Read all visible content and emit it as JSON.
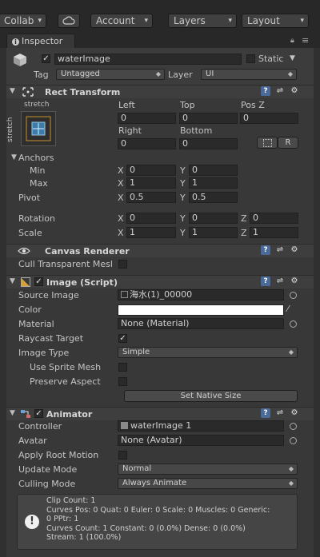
{
  "toolbar": {
    "collab": "Collab",
    "account": "Account",
    "layers": "Layers",
    "layout": "Layout"
  },
  "tab": {
    "label": "Inspector"
  },
  "gameobject": {
    "name": "waterImage",
    "static_label": "Static",
    "tag_label": "Tag",
    "tag_value": "Untagged",
    "layer_label": "Layer",
    "layer_value": "UI"
  },
  "rect_transform": {
    "title": "Rect Transform",
    "anchor_h": "stretch",
    "anchor_v": "stretch",
    "left_label": "Left",
    "left": "0",
    "top_label": "Top",
    "top": "0",
    "posz_label": "Pos Z",
    "posz": "0",
    "right_label": "Right",
    "right": "0",
    "bottom_label": "Bottom",
    "bottom": "0",
    "r_button": "R",
    "anchors_label": "Anchors",
    "min_label": "Min",
    "min_x": "0",
    "min_y": "0",
    "max_label": "Max",
    "max_x": "1",
    "max_y": "1",
    "pivot_label": "Pivot",
    "pivot_x": "0.5",
    "pivot_y": "0.5",
    "rotation_label": "Rotation",
    "rot_x": "0",
    "rot_y": "0",
    "rot_z": "0",
    "scale_label": "Scale",
    "scale_x": "1",
    "scale_y": "1",
    "scale_z": "1",
    "x": "X",
    "y": "Y",
    "z": "Z"
  },
  "canvas_renderer": {
    "title": "Canvas Renderer",
    "cull_label": "Cull Transparent Mesl"
  },
  "image": {
    "title": "Image (Script)",
    "source_label": "Source Image",
    "source_value": "海水(1)_00000",
    "color_label": "Color",
    "material_label": "Material",
    "material_value": "None (Material)",
    "raycast_label": "Raycast Target",
    "type_label": "Image Type",
    "type_value": "Simple",
    "sprite_mesh_label": "Use Sprite Mesh",
    "preserve_label": "Preserve Aspect",
    "native_size_button": "Set Native Size"
  },
  "animator": {
    "title": "Animator",
    "controller_label": "Controller",
    "controller_value": "waterImage 1",
    "avatar_label": "Avatar",
    "avatar_value": "None (Avatar)",
    "root_motion_label": "Apply Root Motion",
    "update_label": "Update Mode",
    "update_value": "Normal",
    "culling_label": "Culling Mode",
    "culling_value": "Always Animate",
    "info_lines": [
      "Clip Count: 1",
      "Curves Pos: 0 Quat: 0 Euler: 0 Scale: 0 Muscles: 0 Generic:",
      "0 PPtr: 1",
      "Curves Count: 1 Constant: 0 (0.0%) Dense: 0 (0.0%)",
      "Stream: 1 (100.0%)"
    ]
  }
}
